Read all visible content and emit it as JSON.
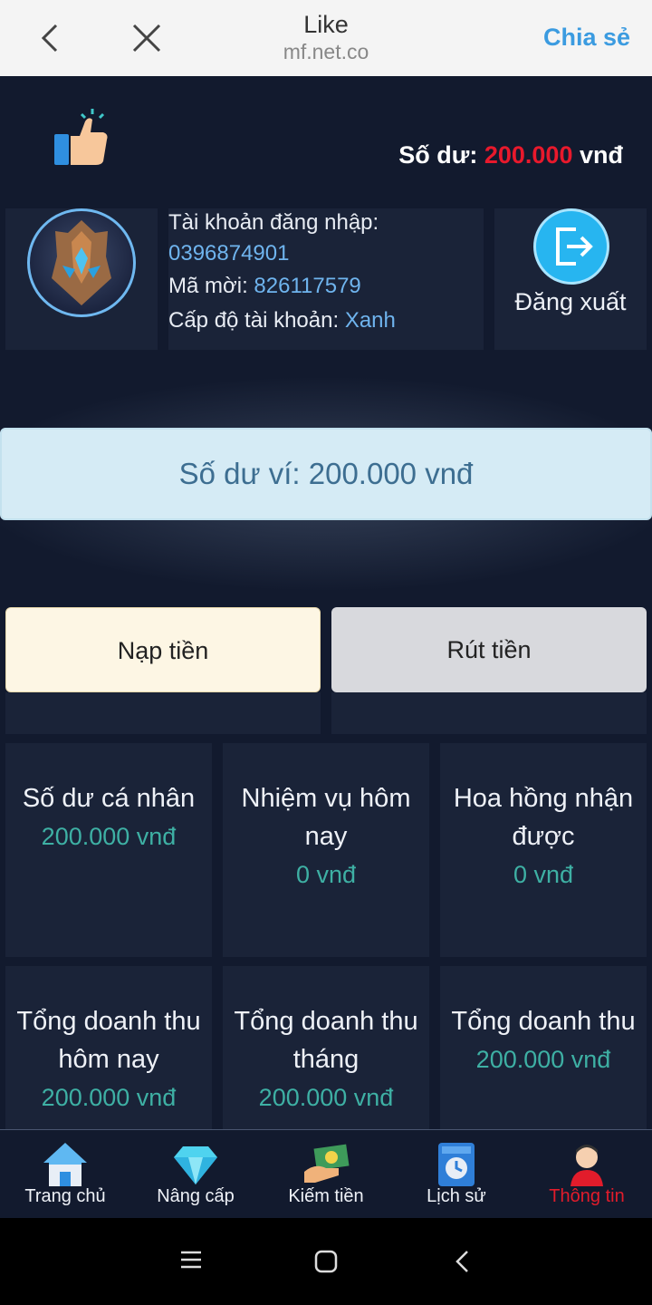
{
  "topbar": {
    "title": "Like",
    "url": "mf.net.co",
    "share_label": "Chia sẻ"
  },
  "header": {
    "balance_label": "Số dư:",
    "balance_amount": "200.000",
    "balance_unit": "vnđ"
  },
  "account": {
    "login_label": "Tài khoản đăng nhập:",
    "login_value": "0396874901",
    "invite_label": "Mã mời:",
    "invite_value": "826117579",
    "level_label": "Cấp độ tài khoản:",
    "level_value": "Xanh",
    "logout_label": "Đăng xuất"
  },
  "wallet": {
    "text": "Số dư ví: 200.000 vnđ"
  },
  "actions": {
    "deposit": "Nạp tiền",
    "withdraw": "Rút tiền"
  },
  "stats": [
    {
      "label": "Số dư cá nhân",
      "value": "200.000 vnđ"
    },
    {
      "label": "Nhiệm vụ hôm nay",
      "value": "0 vnđ"
    },
    {
      "label": "Hoa hồng nhận được",
      "value": "0 vnđ"
    },
    {
      "label": "Tổng doanh thu hôm nay",
      "value": "200.000 vnđ"
    },
    {
      "label": "Tổng doanh thu tháng",
      "value": "200.000 vnđ"
    },
    {
      "label": "Tổng doanh thu",
      "value": "200.000 vnđ"
    }
  ],
  "nav": [
    {
      "label": "Trang chủ",
      "icon": "home-icon"
    },
    {
      "label": "Nâng cấp",
      "icon": "diamond-icon"
    },
    {
      "label": "Kiếm tiền",
      "icon": "money-icon"
    },
    {
      "label": "Lịch sử",
      "icon": "history-icon"
    },
    {
      "label": "Thông tin",
      "icon": "profile-icon",
      "active": true
    }
  ],
  "colors": {
    "accent_red": "#e21c2b",
    "link_blue": "#6fb4ee",
    "value_teal": "#3eb0a4"
  }
}
